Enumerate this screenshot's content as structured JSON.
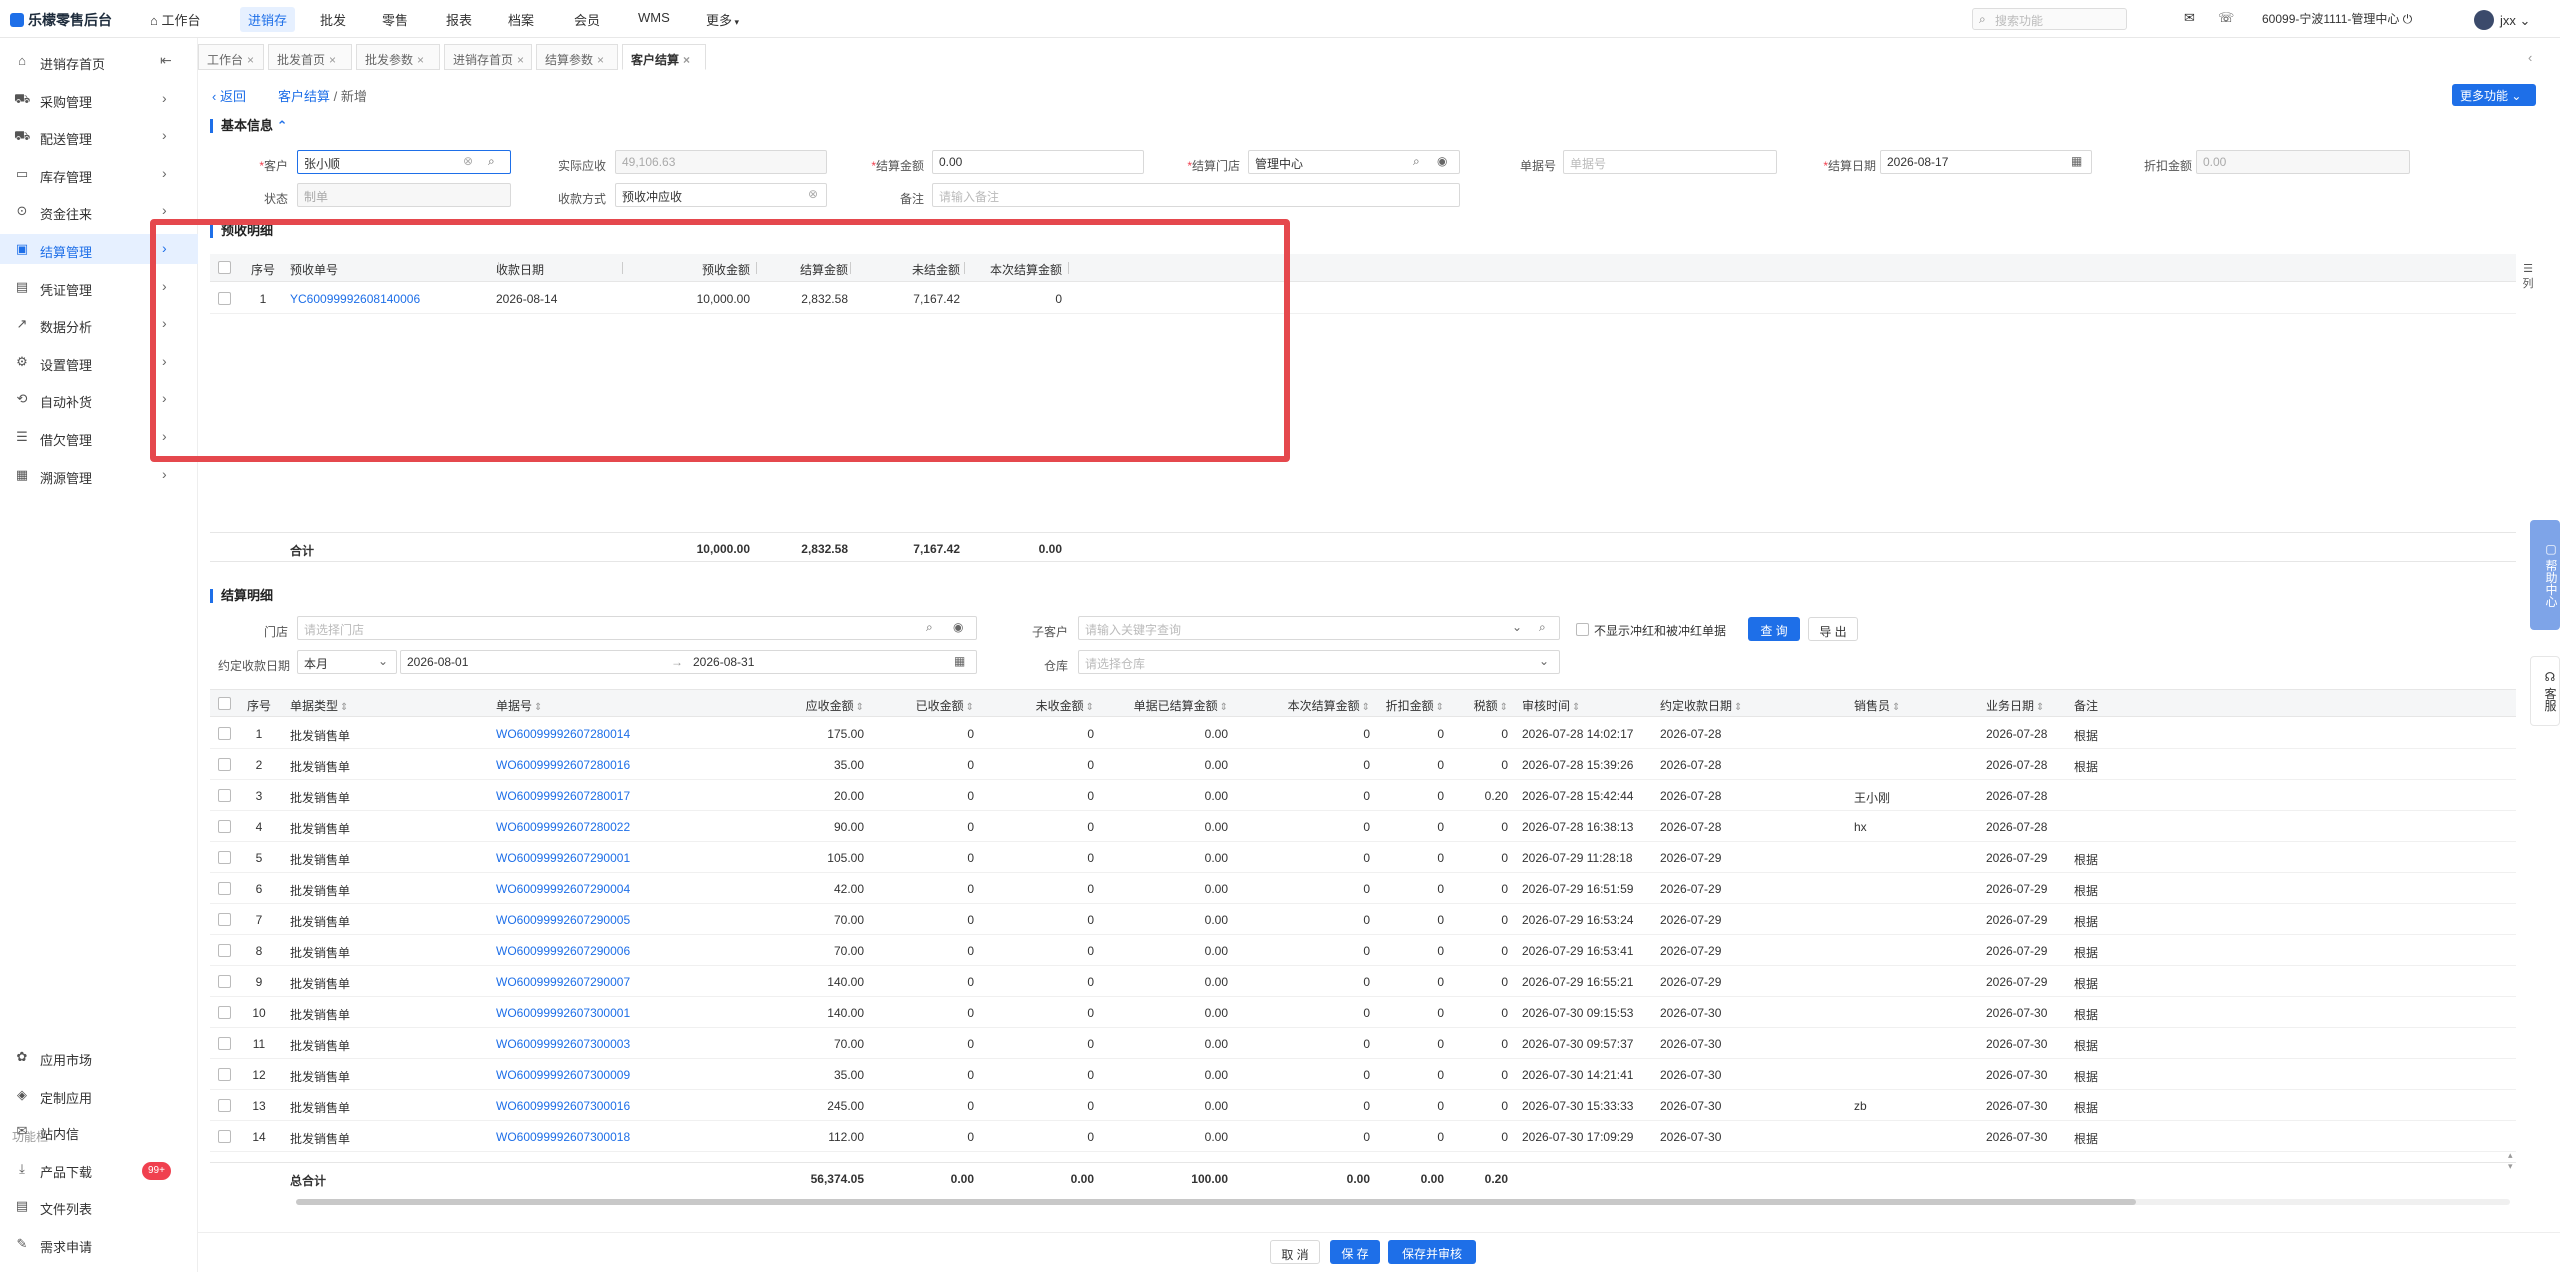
{
  "topnav": {
    "brand": "乐檬零售后台",
    "items": [
      "工作台",
      "进销存",
      "批发",
      "零售",
      "报表",
      "档案",
      "会员",
      "WMS",
      "更多"
    ],
    "active_index": 1,
    "search_placeholder": "搜索功能",
    "store": "60099-宁波1111-管理中心",
    "user": "jxx"
  },
  "sidebar": {
    "items": [
      {
        "label": "进销存首页",
        "icon": "home-icon"
      },
      {
        "label": "采购管理",
        "icon": "cart-icon"
      },
      {
        "label": "配送管理",
        "icon": "truck-icon"
      },
      {
        "label": "库存管理",
        "icon": "box-icon"
      },
      {
        "label": "资金往来",
        "icon": "money-icon"
      },
      {
        "label": "结算管理",
        "icon": "settle-icon"
      },
      {
        "label": "凭证管理",
        "icon": "voucher-icon"
      },
      {
        "label": "数据分析",
        "icon": "chart-icon"
      },
      {
        "label": "设置管理",
        "icon": "gear-icon"
      },
      {
        "label": "自动补货",
        "icon": "replenish-icon"
      },
      {
        "label": "借欠管理",
        "icon": "database-icon"
      },
      {
        "label": "溯源管理",
        "icon": "trace-icon"
      }
    ],
    "active_index": 5,
    "bottom_items": [
      {
        "label": "应用市场",
        "icon": "app-market-icon"
      },
      {
        "label": "定制应用",
        "icon": "custom-app-icon"
      }
    ],
    "func_label": "功能栏",
    "func_items": [
      {
        "label": "站内信",
        "icon": "mail-icon"
      },
      {
        "label": "产品下载",
        "icon": "download-icon"
      },
      {
        "label": "文件列表",
        "icon": "file-icon"
      },
      {
        "label": "需求申请",
        "icon": "request-icon"
      }
    ],
    "badge": "99+"
  },
  "tabs": [
    "工作台",
    "批发首页",
    "批发参数",
    "进销存首页",
    "结算参数",
    "客户结算"
  ],
  "active_tab": 5,
  "page": {
    "back": "返回",
    "crumb1": "客户结算",
    "sep": "/",
    "crumb2": "新增",
    "more": "更多功能"
  },
  "basic": {
    "title": "基本信息",
    "customer_label": "客户",
    "customer_value": "张小顺",
    "actual_label": "实际应收",
    "actual_value": "49,106.63",
    "amount_label": "结算金额",
    "amount_value": "0.00",
    "store_label": "结算门店",
    "store_value": "管理中心",
    "doc_label": "单据号",
    "doc_placeholder": "单据号",
    "date_label": "结算日期",
    "date_value": "2026-08-17",
    "discount_label": "折扣金额",
    "discount_value": "0.00",
    "status_label": "状态",
    "status_value": "制单",
    "method_label": "收款方式",
    "method_value": "预收冲应收",
    "remark_label": "备注",
    "remark_placeholder": "请输入备注"
  },
  "prepay": {
    "title": "预收明细",
    "headers": [
      "序号",
      "预收单号",
      "收款日期",
      "预收金额",
      "结算金额",
      "未结金额",
      "本次结算金额"
    ],
    "rows": [
      {
        "no": "1",
        "doc": "YC60099992608140006",
        "date": "2026-08-14",
        "prepay": "10,000.00",
        "settled": "2,832.58",
        "unsettled": "7,167.42",
        "current": "0"
      }
    ],
    "total_label": "合计",
    "totals": {
      "prepay": "10,000.00",
      "settled": "2,832.58",
      "unsettled": "7,167.42",
      "current": "0.00"
    },
    "col_setting": "列"
  },
  "detail": {
    "title": "结算明细",
    "store_label": "门店",
    "store_placeholder": "请选择门店",
    "sub_label": "子客户",
    "sub_placeholder": "请输入关键字查询",
    "hide_red_label": "不显示冲红和被冲红单据",
    "query": "查 询",
    "export": "导 出",
    "due_label": "约定收款日期",
    "due_period": "本月",
    "due_from": "2026-08-01",
    "due_to": "2026-08-31",
    "wh_label": "仓库",
    "wh_placeholder": "请选择仓库",
    "headers": [
      "序号",
      "单据类型",
      "单据号",
      "应收金额",
      "已收金额",
      "未收金额",
      "单据已结算金额",
      "本次结算金额",
      "折扣金额",
      "税额",
      "审核时间",
      "约定收款日期",
      "销售员",
      "业务日期",
      "备注"
    ],
    "rows": [
      {
        "no": "1",
        "type": "批发销售单",
        "doc": "WO60099992607280014",
        "due": "175.00",
        "recv": "0",
        "unrecv": "0",
        "done": "0.00",
        "cur": "0",
        "disc": "0",
        "tax": "0",
        "audit": "2026-07-28 14:02:17",
        "agreed": "2026-07-28",
        "seller": "",
        "biz": "2026-07-28",
        "note": "根据"
      },
      {
        "no": "2",
        "type": "批发销售单",
        "doc": "WO60099992607280016",
        "due": "35.00",
        "recv": "0",
        "unrecv": "0",
        "done": "0.00",
        "cur": "0",
        "disc": "0",
        "tax": "0",
        "audit": "2026-07-28 15:39:26",
        "agreed": "2026-07-28",
        "seller": "",
        "biz": "2026-07-28",
        "note": "根据"
      },
      {
        "no": "3",
        "type": "批发销售单",
        "doc": "WO60099992607280017",
        "due": "20.00",
        "recv": "0",
        "unrecv": "0",
        "done": "0.00",
        "cur": "0",
        "disc": "0",
        "tax": "0.20",
        "audit": "2026-07-28 15:42:44",
        "agreed": "2026-07-28",
        "seller": "王小刚",
        "biz": "2026-07-28",
        "note": ""
      },
      {
        "no": "4",
        "type": "批发销售单",
        "doc": "WO60099992607280022",
        "due": "90.00",
        "recv": "0",
        "unrecv": "0",
        "done": "0.00",
        "cur": "0",
        "disc": "0",
        "tax": "0",
        "audit": "2026-07-28 16:38:13",
        "agreed": "2026-07-28",
        "seller": "hx",
        "biz": "2026-07-28",
        "note": ""
      },
      {
        "no": "5",
        "type": "批发销售单",
        "doc": "WO60099992607290001",
        "due": "105.00",
        "recv": "0",
        "unrecv": "0",
        "done": "0.00",
        "cur": "0",
        "disc": "0",
        "tax": "0",
        "audit": "2026-07-29 11:28:18",
        "agreed": "2026-07-29",
        "seller": "",
        "biz": "2026-07-29",
        "note": "根据"
      },
      {
        "no": "6",
        "type": "批发销售单",
        "doc": "WO60099992607290004",
        "due": "42.00",
        "recv": "0",
        "unrecv": "0",
        "done": "0.00",
        "cur": "0",
        "disc": "0",
        "tax": "0",
        "audit": "2026-07-29 16:51:59",
        "agreed": "2026-07-29",
        "seller": "",
        "biz": "2026-07-29",
        "note": "根据"
      },
      {
        "no": "7",
        "type": "批发销售单",
        "doc": "WO60099992607290005",
        "due": "70.00",
        "recv": "0",
        "unrecv": "0",
        "done": "0.00",
        "cur": "0",
        "disc": "0",
        "tax": "0",
        "audit": "2026-07-29 16:53:24",
        "agreed": "2026-07-29",
        "seller": "",
        "biz": "2026-07-29",
        "note": "根据"
      },
      {
        "no": "8",
        "type": "批发销售单",
        "doc": "WO60099992607290006",
        "due": "70.00",
        "recv": "0",
        "unrecv": "0",
        "done": "0.00",
        "cur": "0",
        "disc": "0",
        "tax": "0",
        "audit": "2026-07-29 16:53:41",
        "agreed": "2026-07-29",
        "seller": "",
        "biz": "2026-07-29",
        "note": "根据"
      },
      {
        "no": "9",
        "type": "批发销售单",
        "doc": "WO60099992607290007",
        "due": "140.00",
        "recv": "0",
        "unrecv": "0",
        "done": "0.00",
        "cur": "0",
        "disc": "0",
        "tax": "0",
        "audit": "2026-07-29 16:55:21",
        "agreed": "2026-07-29",
        "seller": "",
        "biz": "2026-07-29",
        "note": "根据"
      },
      {
        "no": "10",
        "type": "批发销售单",
        "doc": "WO60099992607300001",
        "due": "140.00",
        "recv": "0",
        "unrecv": "0",
        "done": "0.00",
        "cur": "0",
        "disc": "0",
        "tax": "0",
        "audit": "2026-07-30 09:15:53",
        "agreed": "2026-07-30",
        "seller": "",
        "biz": "2026-07-30",
        "note": "根据"
      },
      {
        "no": "11",
        "type": "批发销售单",
        "doc": "WO60099992607300003",
        "due": "70.00",
        "recv": "0",
        "unrecv": "0",
        "done": "0.00",
        "cur": "0",
        "disc": "0",
        "tax": "0",
        "audit": "2026-07-30 09:57:37",
        "agreed": "2026-07-30",
        "seller": "",
        "biz": "2026-07-30",
        "note": "根据"
      },
      {
        "no": "12",
        "type": "批发销售单",
        "doc": "WO60099992607300009",
        "due": "35.00",
        "recv": "0",
        "unrecv": "0",
        "done": "0.00",
        "cur": "0",
        "disc": "0",
        "tax": "0",
        "audit": "2026-07-30 14:21:41",
        "agreed": "2026-07-30",
        "seller": "",
        "biz": "2026-07-30",
        "note": "根据"
      },
      {
        "no": "13",
        "type": "批发销售单",
        "doc": "WO60099992607300016",
        "due": "245.00",
        "recv": "0",
        "unrecv": "0",
        "done": "0.00",
        "cur": "0",
        "disc": "0",
        "tax": "0",
        "audit": "2026-07-30 15:33:33",
        "agreed": "2026-07-30",
        "seller": "zb",
        "biz": "2026-07-30",
        "note": "根据"
      },
      {
        "no": "14",
        "type": "批发销售单",
        "doc": "WO60099992607300018",
        "due": "112.00",
        "recv": "0",
        "unrecv": "0",
        "done": "0.00",
        "cur": "0",
        "disc": "0",
        "tax": "0",
        "audit": "2026-07-30 17:09:29",
        "agreed": "2026-07-30",
        "seller": "",
        "biz": "2026-07-30",
        "note": "根据"
      }
    ],
    "total_label": "总合计",
    "totals": {
      "due": "56,374.05",
      "recv": "0.00",
      "unrecv": "0.00",
      "done": "100.00",
      "cur": "0.00",
      "disc": "0.00",
      "tax": "0.20"
    }
  },
  "footer": {
    "cancel": "取 消",
    "save": "保 存",
    "save_audit": "保存并审核"
  },
  "float": {
    "help": "帮助中心",
    "service": "客服"
  },
  "colors": {
    "accent": "#1e6fe8",
    "highlight": "#e5484d",
    "badge": "#f0404f"
  }
}
